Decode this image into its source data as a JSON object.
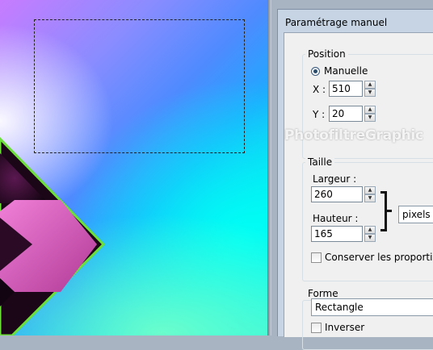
{
  "dialog": {
    "title": "Paramétrage manuel",
    "position": {
      "legend": "Position",
      "mode_label": "Manuelle",
      "x_label": "X :",
      "x_value": "510",
      "y_label": "Y :",
      "y_value": "20"
    },
    "size": {
      "legend": "Taille",
      "width_label": "Largeur :",
      "width_value": "260",
      "height_label": "Hauteur :",
      "height_value": "165",
      "unit": "pixels",
      "keep_proportions_label": "Conserver les proportions"
    },
    "shape": {
      "legend": "Forme",
      "selected": "Rectangle",
      "invert_label": "Inverser"
    }
  },
  "watermark": "PhotofiltreGraphic",
  "colors": {
    "shape_outline": "#6de03a",
    "shape_pink": "#e060c0",
    "shape_dark": "#1a0616"
  }
}
